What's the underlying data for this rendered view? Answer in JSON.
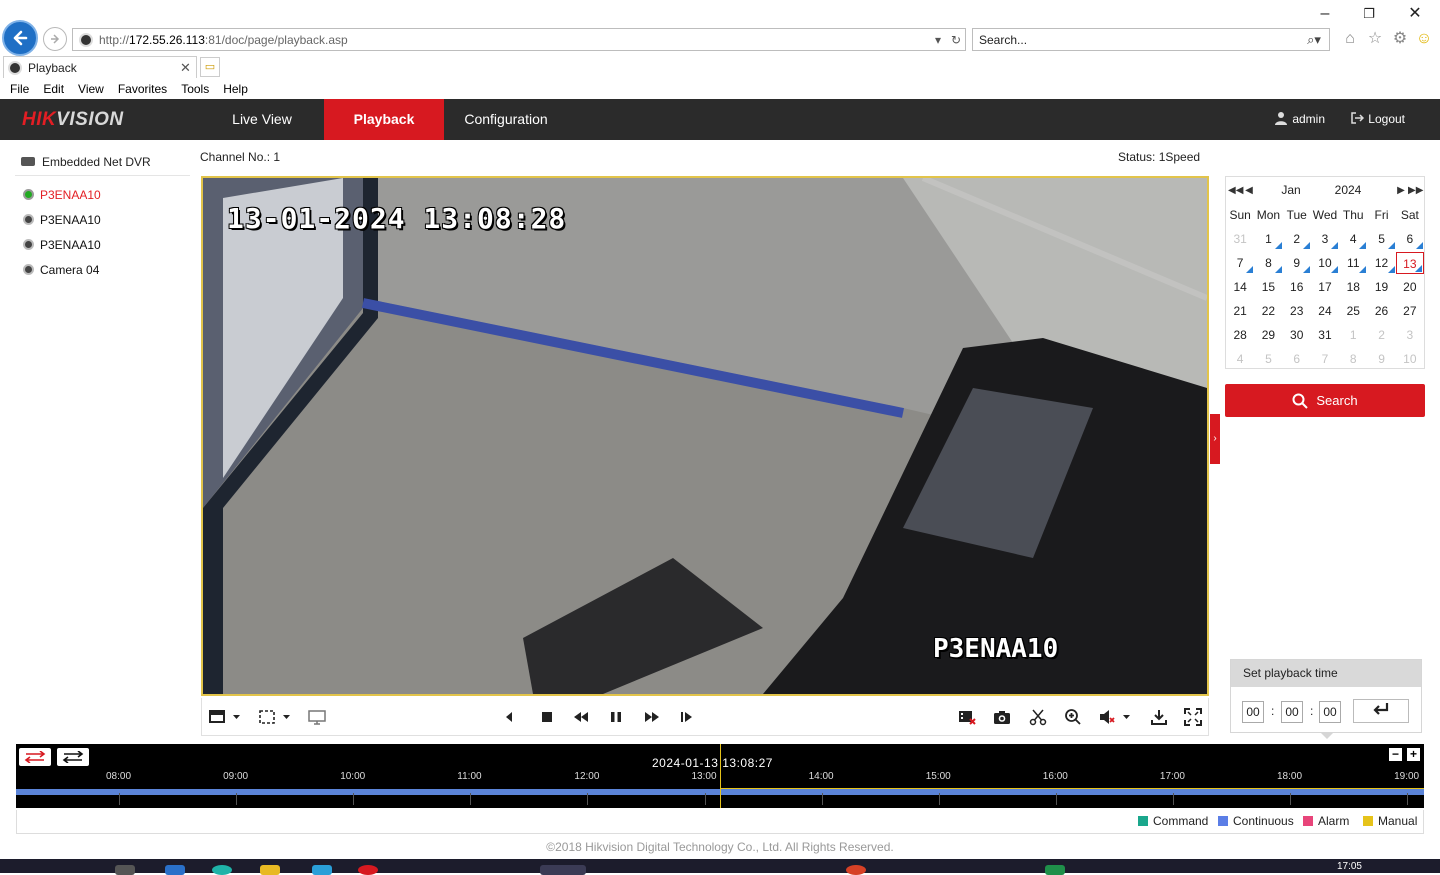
{
  "browser": {
    "url_prefix": "http://",
    "url_host": "172.55.26.113",
    "url_rest": ":81/doc/page/playback.asp",
    "search_placeholder": "Search...",
    "tab_title": "Playback",
    "menu": [
      "File",
      "Edit",
      "View",
      "Favorites",
      "Tools",
      "Help"
    ]
  },
  "header": {
    "logo_hik": "HIK",
    "logo_vision": "VISION",
    "tabs": [
      "Live View",
      "Playback",
      "Configuration"
    ],
    "active_tab": "Playback",
    "user": "admin",
    "logout": "Logout"
  },
  "tree": {
    "root": "Embedded Net DVR",
    "cameras": [
      {
        "name": "P3ENAA10",
        "active": true
      },
      {
        "name": "P3ENAA10",
        "active": false
      },
      {
        "name": "P3ENAA10",
        "active": false
      },
      {
        "name": "Camera 04",
        "active": false
      }
    ]
  },
  "player": {
    "channel_label": "Channel No.: 1",
    "status_label": "Status: 1Speed",
    "osd_time": "13-01-2024 13:08:28",
    "osd_camera": "P3ENAA10"
  },
  "calendar": {
    "month": "Jan",
    "year": "2024",
    "weekdays": [
      "Sun",
      "Mon",
      "Tue",
      "Wed",
      "Thu",
      "Fri",
      "Sat"
    ],
    "weeks": [
      [
        "31",
        "1",
        "2",
        "3",
        "4",
        "5",
        "6"
      ],
      [
        "7",
        "8",
        "9",
        "10",
        "11",
        "12",
        "13"
      ],
      [
        "14",
        "15",
        "16",
        "17",
        "18",
        "19",
        "20"
      ],
      [
        "21",
        "22",
        "23",
        "24",
        "25",
        "26",
        "27"
      ],
      [
        "28",
        "29",
        "30",
        "31",
        "1",
        "2",
        "3"
      ],
      [
        "4",
        "5",
        "6",
        "7",
        "8",
        "9",
        "10"
      ]
    ],
    "selected_day": "13",
    "search_label": "Search"
  },
  "playback_time": {
    "title": "Set playback time",
    "hh": "00",
    "mm": "00",
    "ss": "00"
  },
  "timeline": {
    "current_time": "2024-01-13 13:08:27",
    "hours": [
      "08:00",
      "09:00",
      "10:00",
      "11:00",
      "12:00",
      "13:00",
      "14:00",
      "15:00",
      "16:00",
      "17:00",
      "18:00",
      "19:00"
    ]
  },
  "legend": [
    {
      "label": "Command",
      "color": "#1aa78c"
    },
    {
      "label": "Continuous",
      "color": "#5b7ee6"
    },
    {
      "label": "Alarm",
      "color": "#e8457a"
    },
    {
      "label": "Manual",
      "color": "#e6c31a"
    }
  ],
  "copyright": "©2018 Hikvision Digital Technology Co., Ltd. All Rights Reserved.",
  "taskbar": {
    "clock": "17:05"
  }
}
